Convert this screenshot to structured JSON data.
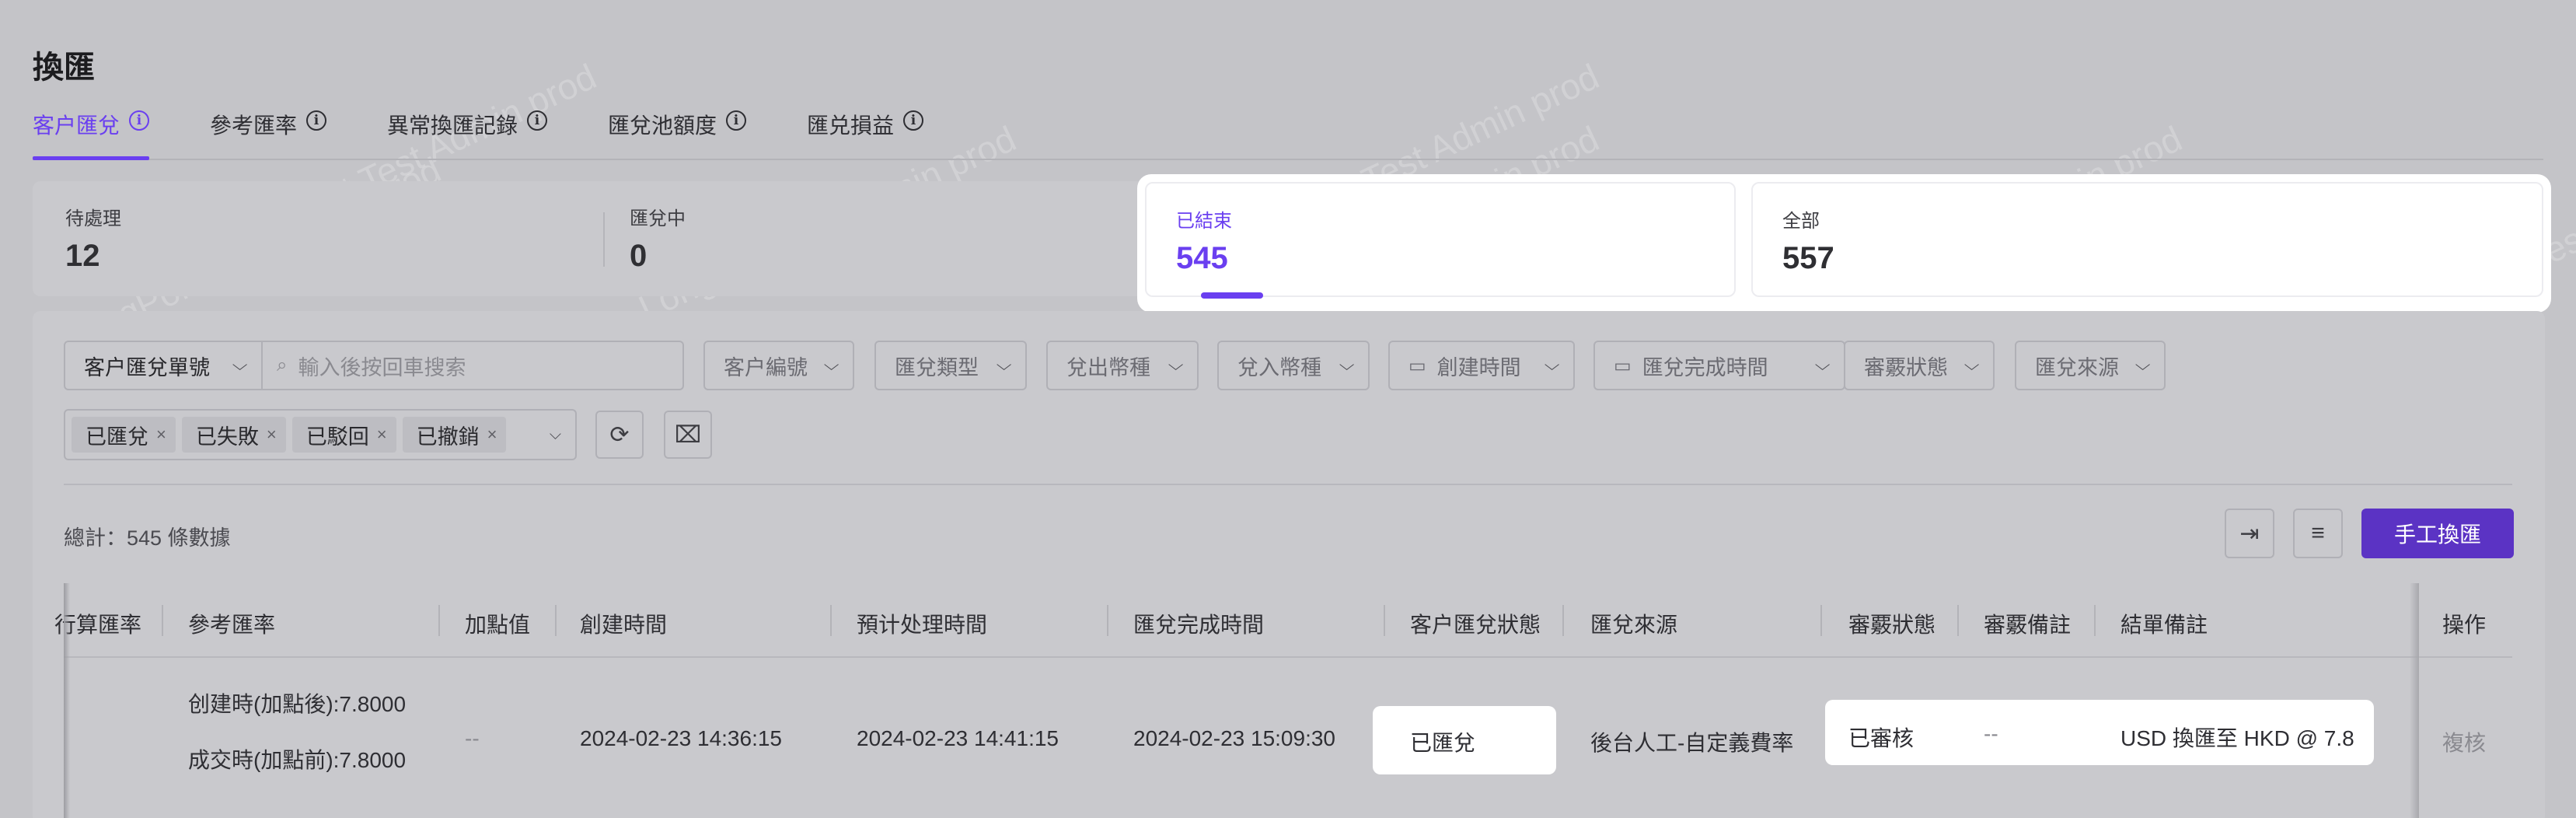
{
  "page_title": "換匯",
  "tabs": [
    {
      "label": "客户匯兌",
      "active": true
    },
    {
      "label": "參考匯率"
    },
    {
      "label": "異常換匯記錄"
    },
    {
      "label": "匯兌池額度"
    },
    {
      "label": "匯兑損益"
    }
  ],
  "stats": [
    {
      "label": "待處理",
      "value": "12"
    },
    {
      "label": "匯兌中",
      "value": "0"
    },
    {
      "label": "已結束",
      "value": "545",
      "active": true
    },
    {
      "label": "全部",
      "value": "557"
    }
  ],
  "filters": {
    "search_type": "客户匯兌單號",
    "search_placeholder": "輸入後按回車搜索",
    "customer_id": "客户編號",
    "exchange_type": "匯兌類型",
    "out_currency": "兌出幣種",
    "in_currency": "兌入幣種",
    "created_time": "創建時間",
    "completed_time": "匯兌完成時間",
    "review_status": "審覈狀態",
    "source": "匯兌來源",
    "status_tags": [
      "已匯兌",
      "已失敗",
      "已駁回",
      "已撤銷"
    ]
  },
  "total_text": "總計：545 條數據",
  "manual_button": "手工換匯",
  "table": {
    "headers": [
      "行算匯率",
      "參考匯率",
      "加點值",
      "創建時間",
      "預计处理時間",
      "匯兌完成時間",
      "客户匯兌狀態",
      "匯兌來源",
      "審覈狀態",
      "審覈備註",
      "結單備註",
      "操作"
    ],
    "row": {
      "ref_rate_line1": "创建時(加點後):7.8000",
      "ref_rate_line2": "成交時(加點前):7.8000",
      "markup": "--",
      "created": "2024-02-23 14:36:15",
      "expected": "2024-02-23 14:41:15",
      "completed": "2024-02-23 15:09:30",
      "status": "已匯兌",
      "source": "後台人工-自定義費率",
      "review_status": "已審核",
      "review_note": "--",
      "close_note": "USD 換匯至 HKD @ 7.8",
      "action": "複核"
    }
  },
  "watermark": "LongPort Test Admin prod"
}
